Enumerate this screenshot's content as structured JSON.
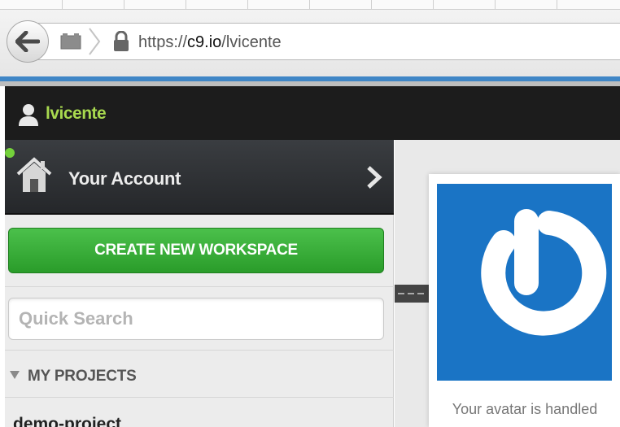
{
  "browser": {
    "url_prefix": "https://",
    "url_host": "c9.io",
    "url_path": "/lvicente",
    "back_icon": "arrow-left-icon",
    "identity_icon": "page-identity-icon",
    "lock_icon": "lock-icon"
  },
  "header": {
    "username": "lvicente",
    "user_icon": "user-silhouette-icon",
    "username_color": "#a8d94f"
  },
  "sidebar": {
    "account_label": "Your Account",
    "account_icon": "home-icon",
    "create_button_label": "CREATE NEW WORKSPACE",
    "search_placeholder": "Quick Search",
    "projects_header": "MY PROJECTS",
    "first_project": "demo-project"
  },
  "main": {
    "avatar_caption": "Your avatar is handled",
    "avatar_color": "#1a74c5"
  },
  "colors": {
    "accent_blue": "#3f86c6",
    "create_green": "#2a9c2a",
    "status_green": "#74d13b"
  }
}
